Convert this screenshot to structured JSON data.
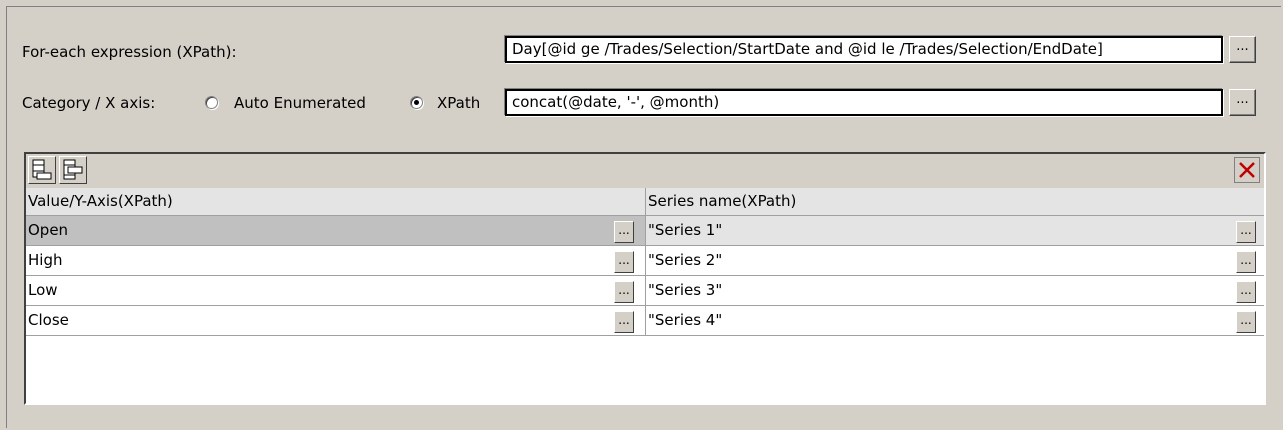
{
  "foreach": {
    "label": "For-each expression (XPath):",
    "value": "Day[@id ge /Trades/Selection/StartDate and @id le /Trades/Selection/EndDate]",
    "browse_label": "..."
  },
  "category": {
    "label": "Category / X axis:",
    "option_auto": "Auto Enumerated",
    "option_xpath": "XPath",
    "selected": "XPath",
    "value": "concat(@date, '-', @month)",
    "browse_label": "..."
  },
  "grid": {
    "toolbar": {
      "append_icon": "append-row-icon",
      "insert_icon": "insert-row-icon",
      "delete_icon": "delete-x-icon",
      "delete_color": "#c00000"
    },
    "columns": [
      "Value/Y-Axis(XPath)",
      "Series name(XPath)"
    ],
    "rows": [
      {
        "value": "Open",
        "series": "\"Series 1\"",
        "selected": true
      },
      {
        "value": "High",
        "series": "\"Series 2\"",
        "selected": false
      },
      {
        "value": "Low",
        "series": "\"Series 3\"",
        "selected": false
      },
      {
        "value": "Close",
        "series": "\"Series 4\"",
        "selected": false
      }
    ],
    "cell_button_label": "..."
  }
}
